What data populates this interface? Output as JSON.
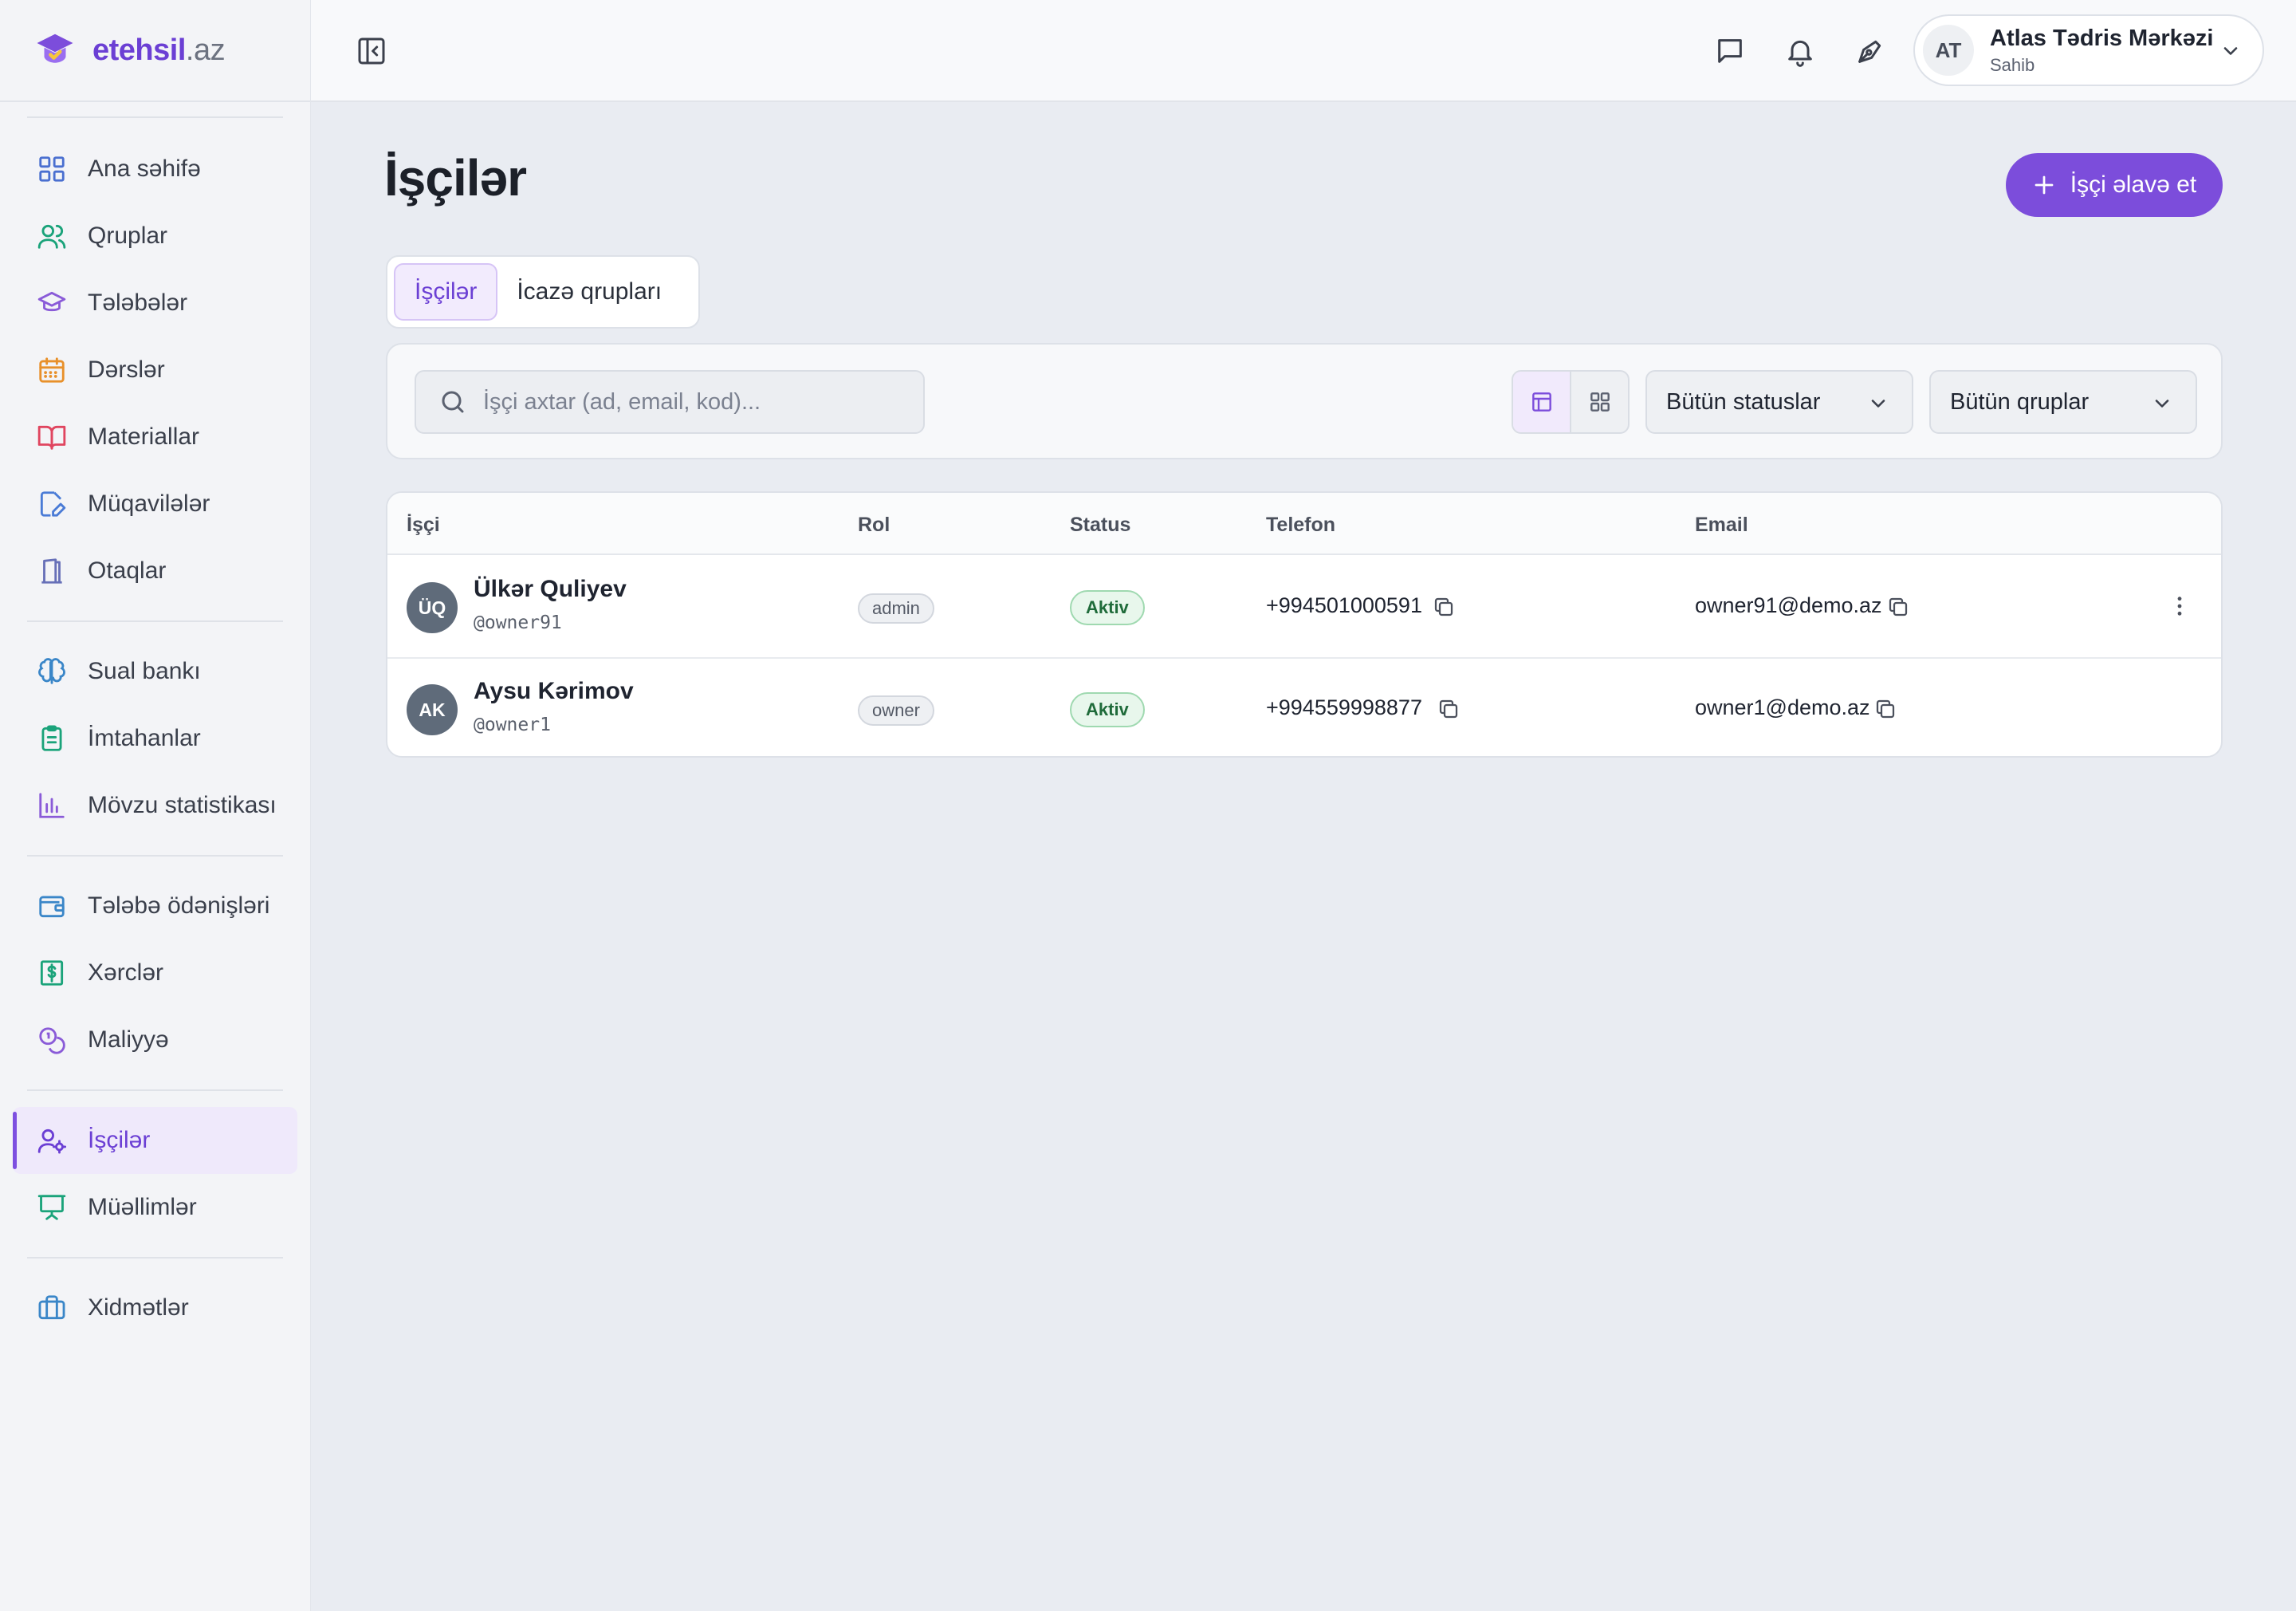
{
  "brand": {
    "name": "etehsil",
    "tld": ".az"
  },
  "sidebar": {
    "groups": [
      [
        {
          "label": "Ana səhifə",
          "icon": "grid-icon"
        },
        {
          "label": "Qruplar",
          "icon": "users-icon"
        },
        {
          "label": "Tələbələr",
          "icon": "graduation-cap-icon"
        },
        {
          "label": "Dərslər",
          "icon": "calendar-icon"
        },
        {
          "label": "Materiallar",
          "icon": "book-open-icon"
        },
        {
          "label": "Müqavilələr",
          "icon": "file-edit-icon"
        },
        {
          "label": "Otaqlar",
          "icon": "door-icon"
        }
      ],
      [
        {
          "label": "Sual bankı",
          "icon": "brain-icon"
        },
        {
          "label": "İmtahanlar",
          "icon": "clipboard-icon"
        },
        {
          "label": "Mövzu statistikası",
          "icon": "bar-chart-icon"
        }
      ],
      [
        {
          "label": "Tələbə ödənişləri",
          "icon": "wallet-icon"
        },
        {
          "label": "Xərclər",
          "icon": "receipt-icon"
        },
        {
          "label": "Maliyyə",
          "icon": "coins-icon"
        }
      ],
      [
        {
          "label": "İşçilər",
          "icon": "user-cog-icon",
          "active": true
        },
        {
          "label": "Müəllimlər",
          "icon": "presentation-icon"
        }
      ],
      [
        {
          "label": "Xidmətlər",
          "icon": "briefcase-icon"
        }
      ]
    ]
  },
  "profile": {
    "initials": "AT",
    "name": "Atlas Tədris Mərkəzi",
    "role": "Sahib"
  },
  "page": {
    "title": "İşçilər",
    "add_button": "İşçi əlavə et"
  },
  "tabs": [
    {
      "label": "İşçilər",
      "active": true
    },
    {
      "label": "İcazə qrupları",
      "active": false
    }
  ],
  "filters": {
    "search_placeholder": "İşçi axtar (ad, email, kod)...",
    "status_select": "Bütün statuslar",
    "group_select": "Bütün qruplar"
  },
  "table": {
    "columns": [
      "İşçi",
      "Rol",
      "Status",
      "Telefon",
      "Email"
    ],
    "rows": [
      {
        "initials": "ÜQ",
        "name": "Ülkər Quliyev",
        "username": "@owner91",
        "role": "admin",
        "status": "Aktiv",
        "phone": "+994501000591",
        "email": "owner91@demo.az"
      },
      {
        "initials": "AK",
        "name": "Aysu Kərimov",
        "username": "@owner1",
        "role": "owner",
        "status": "Aktiv",
        "phone": "+994559998877",
        "email": "owner1@demo.az"
      }
    ]
  },
  "colors": {
    "accent": "#7c4ddb",
    "status_active": "#1f6b3a"
  }
}
